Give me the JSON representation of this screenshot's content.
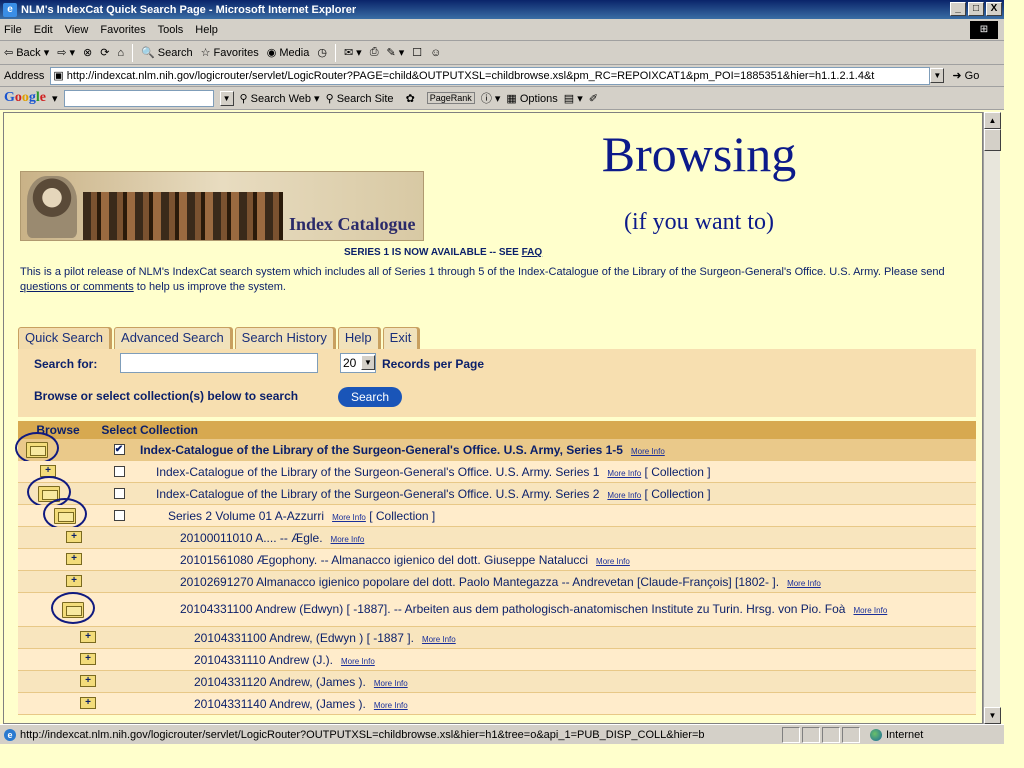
{
  "window": {
    "title": "NLM's IndexCat Quick Search Page - Microsoft Internet Explorer",
    "minimize": "_",
    "maximize": "□",
    "close": "X"
  },
  "menu": [
    "File",
    "Edit",
    "View",
    "Favorites",
    "Tools",
    "Help"
  ],
  "toolbar": {
    "back": "Back",
    "search": "Search",
    "favorites": "Favorites",
    "media": "Media"
  },
  "address": {
    "label": "Address",
    "url": "http://indexcat.nlm.nih.gov/logicrouter/servlet/LogicRouter?PAGE=child&OUTPUTXSL=childbrowse.xsl&pm_RC=REPOIXCAT1&pm_POI=1885351&hier=h1.1.2.1.4&t",
    "go": "Go"
  },
  "google": {
    "logo": "Google",
    "search_web": "Search Web",
    "search_site": "Search Site",
    "pagerank": "PageRank",
    "options": "Options"
  },
  "slide": {
    "headline": "Browsing",
    "subheadline": "(if you want to)"
  },
  "page": {
    "logo_text": "Index Catalogue",
    "series_note": "SERIES 1 IS NOW AVAILABLE -- SEE ",
    "faq_link": "FAQ",
    "intro_1": "This is a pilot release of NLM's IndexCat search system which includes all of Series 1 through 5 of the Index-Catalogue of the Library of the Surgeon-General's Office. U.S. Army. Please send ",
    "intro_link": "questions or comments",
    "intro_2": " to help us improve the system.",
    "tabs": [
      "Quick Search",
      "Advanced Search",
      "Search History",
      "Help",
      "Exit"
    ],
    "search_for_label": "Search for:",
    "records_value": "20",
    "records_label": "Records per Page",
    "browse_label": "Browse or select collection(s) below to search",
    "search_button": "Search"
  },
  "table": {
    "headers": [
      "Browse",
      "Select",
      "Collection"
    ],
    "more_info": "More Info",
    "rows": [
      {
        "text": "Index-Catalogue of the Library of the Surgeon-General's Office. U.S. Army, Series 1-5",
        "suffix": "",
        "check": "✔"
      },
      {
        "text": "Index-Catalogue of the Library of the Surgeon-General's Office. U.S. Army. Series 1",
        "suffix": "[ Collection ]",
        "check": ""
      },
      {
        "text": "Index-Catalogue of the Library of the Surgeon-General's Office. U.S. Army. Series 2",
        "suffix": "[ Collection ]",
        "check": ""
      },
      {
        "text": "Series 2 Volume 01 A-Azzurri",
        "suffix": "[ Collection ]",
        "check": ""
      },
      {
        "text": "20100011010 A.... -- Ægle.",
        "suffix": ""
      },
      {
        "text": "20101561080 Ægophony. -- Almanacco igienico del dott. Giuseppe Natalucci",
        "suffix": ""
      },
      {
        "text": "20102691270 Almanacco igienico popolare del dott. Paolo Mantegazza -- Andrevetan [Claude-François] [1802-   ].",
        "suffix": ""
      },
      {
        "text": "20104331100 Andrew (Edwyn) [   -1887]. -- Arbeiten aus dem pathologisch-anatomischen Institute zu Turin. Hrsg. von Pio. Foà",
        "suffix": ""
      },
      {
        "text": "20104331100 Andrew, (Edwyn ) [   -1887 ].",
        "suffix": ""
      },
      {
        "text": "20104331110 Andrew (J.).",
        "suffix": ""
      },
      {
        "text": "20104331120 Andrew, (James ).",
        "suffix": ""
      },
      {
        "text": "20104331140 Andrew, (James ).",
        "suffix": ""
      }
    ]
  },
  "status": {
    "url": "http://indexcat.nlm.nih.gov/logicrouter/servlet/LogicRouter?OUTPUTXSL=childbrowse.xsl&hier=h1&tree=o&api_1=PUB_DISP_COLL&hier=b",
    "zone": "Internet"
  }
}
